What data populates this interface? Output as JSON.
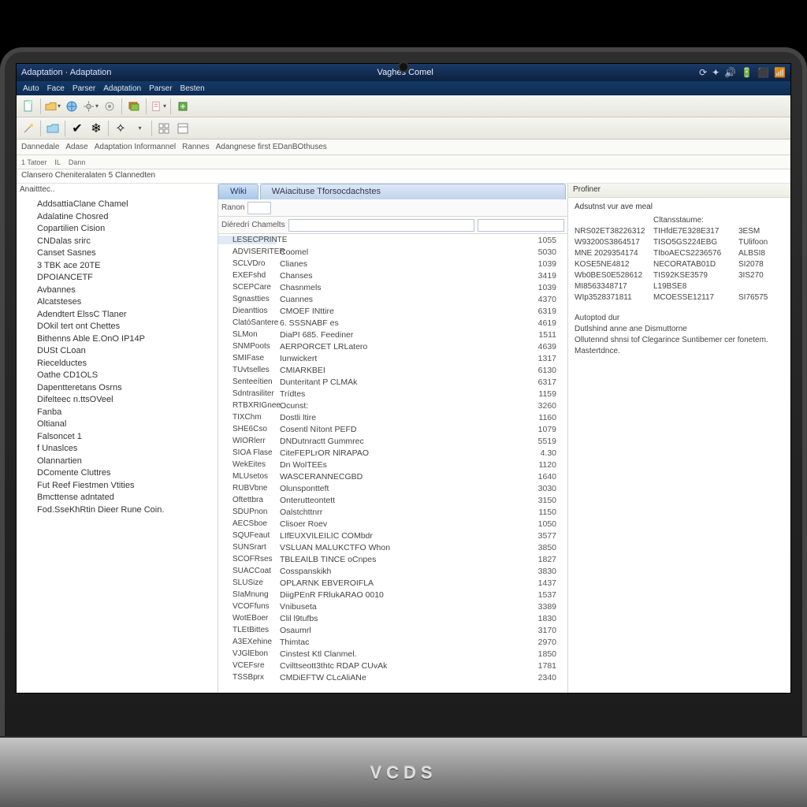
{
  "titlebar": {
    "left": "Adaptation · Adaptation",
    "center": "Vaghes Comel"
  },
  "menu": [
    "Auto",
    "Face",
    "Parser",
    "Adaptation",
    "Parser",
    "Besten"
  ],
  "subtabs_row1": [
    "Dannedale",
    "Adase",
    "Adaptation Informannel",
    "Rannes",
    "Adangnese first EDanBOthuses"
  ],
  "subtabs_row2": [
    "1 Tatoer",
    "IL",
    "Dann"
  ],
  "breadcrumb": "Clansero Cheniteralaten 5 Clannedten",
  "left_head": "Anaitttec..",
  "left_items": [
    "AddsattiaClane Chamel",
    "Adalatine Chosred",
    "Copartilien Cision",
    "CNDalas srirc",
    "Canset Sasnes",
    "3 TBK ace 20TE",
    "DPOIANCETF",
    "Avbannes",
    "Alcatsteses",
    "Adendtert ElssC Tlaner",
    "DOkil tert ont Chettes",
    "Bithenns Able E.OnO IP14P",
    "DUSt CLoan",
    "Riecelductes",
    "Oathe CD1OLS",
    "Dapentteretans Osrns",
    "Difelteec n.ttsOVeel",
    "Fanba",
    "Oltianal",
    "Falsoncet 1",
    "f Unaslces",
    "Olannartien",
    "DComente Cluttres",
    "Fut Reef Fiestmen Vtities",
    "Bmcttense adntated",
    "Fod.SseKhRtin Dieer Rune Coin."
  ],
  "center": {
    "tab1": "Wiki",
    "tab2": "WAiacituse Tforsocdachstes",
    "filter_label": "Ranon",
    "header_label": "Diéredrí Chamelts",
    "rows": [
      {
        "code": "LESECPRINTE",
        "name": "",
        "val": "1055",
        "hl": true
      },
      {
        "code": "ADVISERITER",
        "name": "Coomel",
        "val": "5030"
      },
      {
        "code": "SCLVDro",
        "name": "Clianes",
        "val": "1039"
      },
      {
        "code": "EXEFshd",
        "name": "Chanses",
        "val": "3419"
      },
      {
        "code": "SCEPCare",
        "name": "Chasnmels",
        "val": "1039"
      },
      {
        "code": "Sgnastties",
        "name": "Cuannes",
        "val": "4370"
      },
      {
        "code": "Dieanttios",
        "name": "CMOEF INttire",
        "val": "6319"
      },
      {
        "code": "ClatóSantere",
        "name": "6. SSSNABF es",
        "val": "4619"
      },
      {
        "code": "SLMon",
        "name": "DiaPI 685. Feediner",
        "val": "1511"
      },
      {
        "code": "SNMPoots",
        "name": "AERPORCET LRLatero",
        "val": "4639"
      },
      {
        "code": "SMIFase",
        "name": "Iunwickert",
        "val": "1317"
      },
      {
        "code": "TUvtselles",
        "name": "CMIARKBEI",
        "val": "6130"
      },
      {
        "code": "Senteeítien",
        "name": "Dunteritant P CLMAk",
        "val": "6317"
      },
      {
        "code": "Sdntrasiliter",
        "name": "Trídtes",
        "val": "1159"
      },
      {
        "code": "RTBXRIGnee",
        "name": "Ocunst:",
        "val": "3260"
      },
      {
        "code": "TIXChm",
        "name": "Dostli ltire",
        "val": "1160"
      },
      {
        "code": "SHE6Cso",
        "name": "Cosentl Nítont PEFD",
        "val": "1079"
      },
      {
        "code": "WIORlerr",
        "name": "DNDutnractt Gummrec",
        "val": "5519"
      },
      {
        "code": "SIOA Flase",
        "name": "CiteFEPLrOR NlRAPAO",
        "val": "4.30"
      },
      {
        "code": "WekEites",
        "name": "Dn WolTEEs",
        "val": "1120"
      },
      {
        "code": "MLUsetos",
        "name": "WASCERANNECGBD",
        "val": "1640"
      },
      {
        "code": "RUBVbne",
        "name": "Olunspontteft",
        "val": "3030"
      },
      {
        "code": "Oftettbra",
        "name": "Onterutteontett",
        "val": "3150"
      },
      {
        "code": "SDUPnon",
        "name": "Oalstchttnrr",
        "val": "1150"
      },
      {
        "code": "AECSboe",
        "name": "Clisoer Roev",
        "val": "1050"
      },
      {
        "code": "SQUFeaut",
        "name": "LIfEUXVILEILIC COMbdr",
        "val": "3577"
      },
      {
        "code": "SUNSrart",
        "name": "VSLUAN MALUKCTFO Whon",
        "val": "3850"
      },
      {
        "code": "SCOFRses",
        "name": "TBLEAILB TINCE oCnpes",
        "val": "1827"
      },
      {
        "code": "SUACCoat",
        "name": "Cosspanskikh",
        "val": "3830"
      },
      {
        "code": "SLUSize",
        "name": "OPLARNK EBVEROIFLA",
        "val": "1437"
      },
      {
        "code": "SIaMnung",
        "name": "DiigPEnR FRlukARAO 0010",
        "val": "1537"
      },
      {
        "code": "VCOFfuns",
        "name": "Vnibuseta",
        "val": "3389"
      },
      {
        "code": "WotEBoer",
        "name": "Clil l9tufbs",
        "val": "1830"
      },
      {
        "code": "TLEtBittes",
        "name": "Osaumrl",
        "val": "3170"
      },
      {
        "code": "A3EXehine",
        "name": "Thimtac",
        "val": "2970"
      },
      {
        "code": "VJGlEbon",
        "name": "Cinstest Ktl Clanmel.",
        "val": "1850"
      },
      {
        "code": "VCEFsre",
        "name": "Cvilttseott3thtc RDAP CUvAk",
        "val": "1781"
      },
      {
        "code": "TSSBprx",
        "name": "CMDiEFTW CLcAliANe",
        "val": "2340"
      }
    ]
  },
  "right": {
    "header": "Profiner",
    "section_title": "Adsutnst vur ave meal",
    "col_b_header": "Cltansstaume:",
    "grid": [
      {
        "a": "NRS02ET38226312",
        "b": "TIHfdE7E328E317",
        "c": "3ESM"
      },
      {
        "a": "W93200S3864517",
        "b": "TISO5GS224EBG",
        "c": "TUlifoon"
      },
      {
        "a": "MNE 2029354174",
        "b": "TIboAECS2236576",
        "c": "ALBSI8"
      },
      {
        "a": "KOSE5NE4812",
        "b": "NECORATAB01D",
        "c": "SI2078"
      },
      {
        "a": "Wb0BES0E528612",
        "b": "TIS92KSE3579",
        "c": "3IS270"
      },
      {
        "a": "MI8563348717",
        "b": "L19BSE8",
        "c": " "
      },
      {
        "a": "WIp3528371811",
        "b": "MCOESSE12117",
        "c": "SI76575"
      }
    ],
    "notes": [
      "Autoptod dur",
      "Dutlshind anne ane  Dismuttorne",
      "Ollutennd shnsi tof  Clegarince Suntibemer cer fonetem.",
      "Mastertdnce."
    ]
  },
  "brand": "VCDS"
}
